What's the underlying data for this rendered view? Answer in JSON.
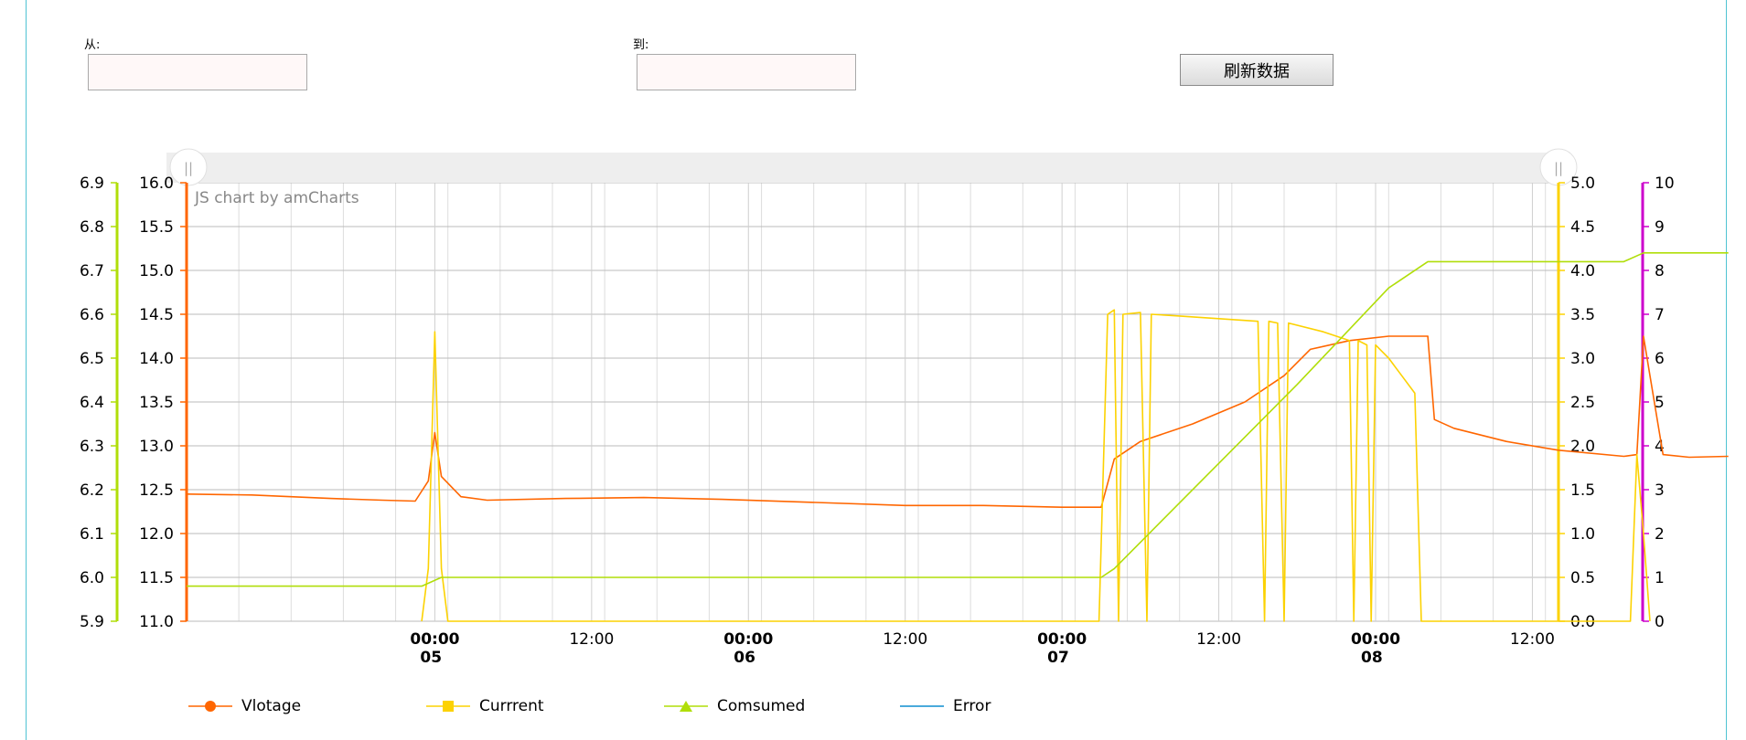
{
  "filter": {
    "from_label": "从:",
    "to_label": "到:",
    "from_value": "",
    "to_value": "",
    "refresh_label": "刷新数据"
  },
  "watermark": "JS chart by amCharts",
  "scrollbar": {
    "left_handle": "||",
    "right_handle": "||"
  },
  "colors": {
    "voltage": "#ff6600",
    "current": "#fcd202",
    "consumed": "#b0de09",
    "error": "#0d8ecf",
    "error_axis": "#cc00cc",
    "frame": "#4fc3d3"
  },
  "chart_data": {
    "type": "line",
    "x_range": [
      "2024-11-04 05:00",
      "2024-11-08 14:00"
    ],
    "x_ticks": [
      {
        "t": "2024-11-05 00:00",
        "label": "00:00",
        "sublabel": "05",
        "bold": true
      },
      {
        "t": "2024-11-05 12:00",
        "label": "12:00",
        "sublabel": "",
        "bold": false
      },
      {
        "t": "2024-11-06 00:00",
        "label": "00:00",
        "sublabel": "06",
        "bold": true
      },
      {
        "t": "2024-11-06 12:00",
        "label": "12:00",
        "sublabel": "",
        "bold": false
      },
      {
        "t": "2024-11-07 00:00",
        "label": "00:00",
        "sublabel": "07",
        "bold": true
      },
      {
        "t": "2024-11-07 12:00",
        "label": "12:00",
        "sublabel": "",
        "bold": false
      },
      {
        "t": "2024-11-08 00:00",
        "label": "00:00",
        "sublabel": "08",
        "bold": true
      },
      {
        "t": "2024-11-08 12:00",
        "label": "12:00",
        "sublabel": "",
        "bold": false
      }
    ],
    "axes": [
      {
        "id": "consumed",
        "position": "left-outer",
        "min": 5.9,
        "max": 6.9,
        "step": 0.1,
        "decimals": 1,
        "color": "#b0de09"
      },
      {
        "id": "voltage",
        "position": "left-inner",
        "min": 11.0,
        "max": 16.0,
        "step": 0.5,
        "decimals": 1,
        "color": "#ff6600"
      },
      {
        "id": "current",
        "position": "right-inner",
        "min": 0.0,
        "max": 5.0,
        "step": 0.5,
        "decimals": 1,
        "color": "#fcd202"
      },
      {
        "id": "error",
        "position": "right-outer",
        "min": 0,
        "max": 10,
        "step": 1,
        "decimals": 0,
        "color": "#cc00cc"
      }
    ],
    "grid": true,
    "legend_position": "bottom",
    "series": [
      {
        "name": "Vlotage",
        "axis": "voltage",
        "color": "#ff6600",
        "marker": "circle",
        "points": [
          [
            "2024-11-04 05:00",
            12.45
          ],
          [
            "2024-11-04 10:00",
            12.44
          ],
          [
            "2024-11-04 16:00",
            12.4
          ],
          [
            "2024-11-04 20:00",
            12.38
          ],
          [
            "2024-11-04 22:30",
            12.37
          ],
          [
            "2024-11-04 23:30",
            12.6
          ],
          [
            "2024-11-05 00:00",
            13.15
          ],
          [
            "2024-11-05 00:30",
            12.65
          ],
          [
            "2024-11-05 02:00",
            12.42
          ],
          [
            "2024-11-05 04:00",
            12.38
          ],
          [
            "2024-11-05 10:00",
            12.4
          ],
          [
            "2024-11-05 16:00",
            12.41
          ],
          [
            "2024-11-05 22:00",
            12.39
          ],
          [
            "2024-11-06 04:00",
            12.36
          ],
          [
            "2024-11-06 12:00",
            12.32
          ],
          [
            "2024-11-06 18:00",
            12.32
          ],
          [
            "2024-11-07 00:00",
            12.3
          ],
          [
            "2024-11-07 02:00",
            12.3
          ],
          [
            "2024-11-07 03:00",
            12.3
          ],
          [
            "2024-11-07 04:00",
            12.85
          ],
          [
            "2024-11-07 06:00",
            13.05
          ],
          [
            "2024-11-07 10:00",
            13.25
          ],
          [
            "2024-11-07 14:00",
            13.5
          ],
          [
            "2024-11-07 17:00",
            13.8
          ],
          [
            "2024-11-07 19:00",
            14.1
          ],
          [
            "2024-11-07 22:00",
            14.2
          ],
          [
            "2024-11-08 01:00",
            14.25
          ],
          [
            "2024-11-08 03:00",
            14.25
          ],
          [
            "2024-11-08 04:00",
            14.25
          ],
          [
            "2024-11-08 04:30",
            13.3
          ],
          [
            "2024-11-08 06:00",
            13.2
          ],
          [
            "2024-11-08 10:00",
            13.05
          ],
          [
            "2024-11-08 14:00",
            12.95
          ],
          [
            "2024-11-08 19:00",
            12.88
          ],
          [
            "2024-11-08 20:00",
            12.9
          ],
          [
            "2024-11-08 20:30",
            14.25
          ],
          [
            "2024-11-08 21:00",
            13.8
          ],
          [
            "2024-11-08 22:00",
            12.9
          ],
          [
            "2024-11-09 00:00",
            12.87
          ],
          [
            "2024-11-09 03:00",
            12.88
          ]
        ]
      },
      {
        "name": "Currrent",
        "axis": "current",
        "color": "#fcd202",
        "marker": "square",
        "points": [
          [
            "2024-11-04 23:00",
            0.0
          ],
          [
            "2024-11-04 23:30",
            0.6
          ],
          [
            "2024-11-05 00:00",
            3.3
          ],
          [
            "2024-11-05 00:30",
            0.6
          ],
          [
            "2024-11-05 01:00",
            0.0
          ],
          [
            "2024-11-07 02:50",
            0.0
          ],
          [
            "2024-11-07 03:30",
            3.5
          ],
          [
            "2024-11-07 04:00",
            3.55
          ],
          [
            "2024-11-07 04:20",
            0.0
          ],
          [
            "2024-11-07 04:40",
            3.5
          ],
          [
            "2024-11-07 06:00",
            3.52
          ],
          [
            "2024-11-07 06:30",
            0.0
          ],
          [
            "2024-11-07 06:50",
            3.5
          ],
          [
            "2024-11-07 09:00",
            3.48
          ],
          [
            "2024-11-07 12:00",
            3.45
          ],
          [
            "2024-11-07 15:00",
            3.42
          ],
          [
            "2024-11-07 15:30",
            0.0
          ],
          [
            "2024-11-07 15:50",
            3.42
          ],
          [
            "2024-11-07 16:30",
            3.4
          ],
          [
            "2024-11-07 17:00",
            0.0
          ],
          [
            "2024-11-07 17:20",
            3.4
          ],
          [
            "2024-11-07 20:00",
            3.3
          ],
          [
            "2024-11-07 22:00",
            3.2
          ],
          [
            "2024-11-07 22:20",
            0.0
          ],
          [
            "2024-11-07 22:40",
            3.2
          ],
          [
            "2024-11-07 23:20",
            3.15
          ],
          [
            "2024-11-07 23:40",
            0.0
          ],
          [
            "2024-11-08 00:00",
            3.15
          ],
          [
            "2024-11-08 01:00",
            3.0
          ],
          [
            "2024-11-08 02:00",
            2.8
          ],
          [
            "2024-11-08 03:00",
            2.6
          ],
          [
            "2024-11-08 03:30",
            0.0
          ],
          [
            "2024-11-08 19:30",
            0.0
          ],
          [
            "2024-11-08 20:00",
            1.9
          ],
          [
            "2024-11-08 20:30",
            1.0
          ],
          [
            "2024-11-08 21:00",
            0.0
          ]
        ]
      },
      {
        "name": "Comsumed",
        "axis": "consumed",
        "color": "#b0de09",
        "marker": "triangle",
        "points": [
          [
            "2024-11-04 05:00",
            5.98
          ],
          [
            "2024-11-04 23:00",
            5.98
          ],
          [
            "2024-11-05 00:30",
            6.0
          ],
          [
            "2024-11-07 03:00",
            6.0
          ],
          [
            "2024-11-07 04:00",
            6.02
          ],
          [
            "2024-11-07 11:00",
            6.23
          ],
          [
            "2024-11-07 18:00",
            6.44
          ],
          [
            "2024-11-08 01:00",
            6.66
          ],
          [
            "2024-11-08 04:00",
            6.72
          ],
          [
            "2024-11-08 19:00",
            6.72
          ],
          [
            "2024-11-08 20:30",
            6.74
          ],
          [
            "2024-11-09 03:00",
            6.74
          ]
        ]
      },
      {
        "name": "Error",
        "axis": "error",
        "color": "#0d8ecf",
        "marker": "line",
        "points": []
      }
    ]
  }
}
